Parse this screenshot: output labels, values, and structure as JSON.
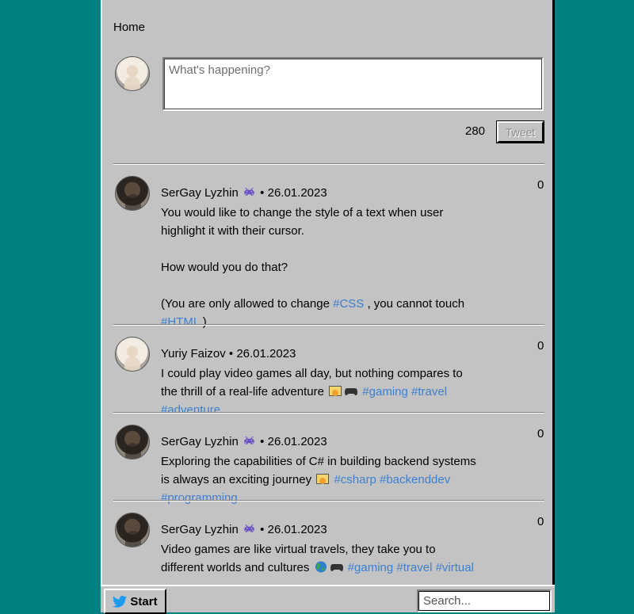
{
  "page": {
    "title": "Home"
  },
  "compose": {
    "placeholder": "What's happening?",
    "char_count": "280",
    "tweet_label": "Tweet"
  },
  "posts": [
    {
      "author": "SerGay Lyzhin",
      "date": "26.01.2023",
      "likes": "0",
      "text_1": "You would like to change the style of a text when user highlight it with their cursor.",
      "text_2": "How would you do that?",
      "text_3a": "(You are only allowed to change ",
      "tag_css": "#CSS",
      "text_3b": " , you cannot touch ",
      "tag_html": "#HTML",
      "text_3c": " )"
    },
    {
      "author": "Yuriy Faizov",
      "date": "26.01.2023",
      "likes": "0",
      "text": "I could play video games all day, but nothing compares to the thrill of a real-life adventure",
      "tags": [
        "#gaming",
        "#travel",
        "#adventure"
      ]
    },
    {
      "author": "SerGay Lyzhin",
      "date": "26.01.2023",
      "likes": "0",
      "text": "Exploring the capabilities of C# in building backend systems is always an exciting journey",
      "tags": [
        "#csharp",
        "#backenddev",
        "#programming"
      ]
    },
    {
      "author": "SerGay Lyzhin",
      "date": "26.01.2023",
      "likes": "0",
      "text": "Video games are like virtual travels, they take you to different worlds and cultures",
      "tags": [
        "#gaming",
        "#travel",
        "#virtual"
      ]
    }
  ],
  "meta_separator": "•",
  "taskbar": {
    "start_label": "Start",
    "search_placeholder": "Search..."
  },
  "colors": {
    "desktop": "#008080",
    "window": "#c3c3c3",
    "hashtag": "#3d7fd0"
  },
  "icons": {
    "badge": "space-invader-icon",
    "start": "twitter-bird-icon"
  }
}
